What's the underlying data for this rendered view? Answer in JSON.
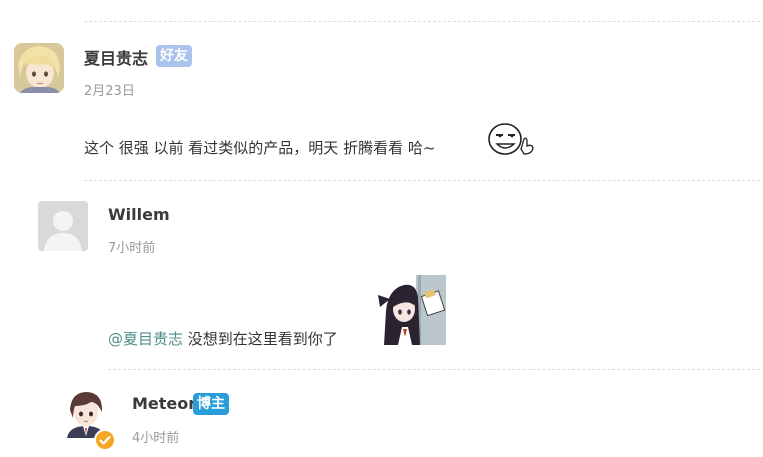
{
  "colors": {
    "accent": "#2a9dd8",
    "friend_badge": "#a9c3ec",
    "mention": "#4d8f8a",
    "verified": "#f5a623"
  },
  "comments": [
    {
      "author": "夏目贵志",
      "badge": "好友",
      "date": "2月23日",
      "text": "这个 很强 以前 看过类似的产品，明天 折腾看看 哈~",
      "sticker": "smug-face-emoji"
    },
    {
      "author": "Willem",
      "date": "7小时前",
      "mention": "@夏目贵志",
      "text": "没想到在这里看到你了",
      "sticker": "anime-girl-holding-note-sticker"
    },
    {
      "author": "Meteor",
      "badge": "博主",
      "date": "4小时前",
      "verified_icon": "check-badge-icon"
    }
  ]
}
